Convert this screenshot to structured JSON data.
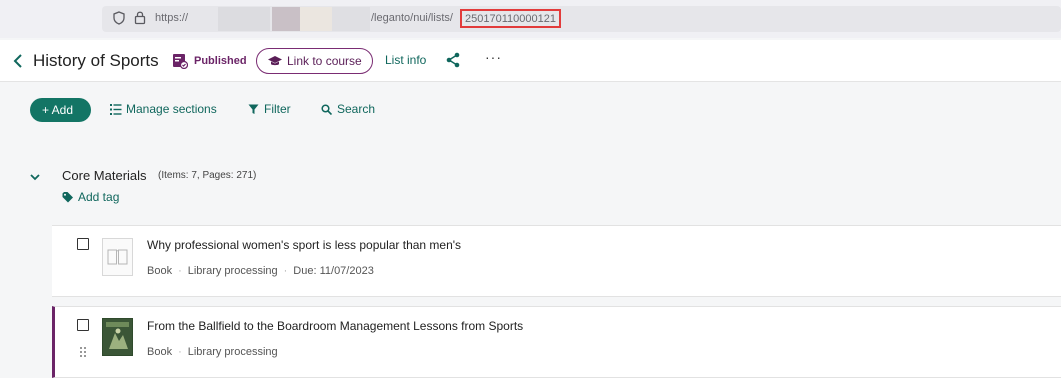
{
  "browser": {
    "url_protocol": "https://",
    "url_path": "/leganto/nui/lists/",
    "url_list_id": "250170110000121"
  },
  "header": {
    "title": "History of Sports",
    "status": "Published",
    "link_course_label": "Link to course",
    "list_info_label": "List info",
    "more_label": "···"
  },
  "toolbar": {
    "add_label": "+ Add",
    "manage_sections_label": "Manage sections",
    "filter_label": "Filter",
    "search_label": "Search"
  },
  "section": {
    "title": "Core Materials",
    "meta": "(Items: 7, Pages: 271)",
    "add_tag_label": "Add tag"
  },
  "items": [
    {
      "title": "Why professional women's sport is less popular than men's",
      "type": "Book",
      "status": "Library processing",
      "due": "Due: 11/07/2023"
    },
    {
      "title": "From the Ballfield to the Boardroom Management Lessons from Sports",
      "type": "Book",
      "status": "Library processing"
    }
  ],
  "colors": {
    "primary_green": "#137565",
    "link_green": "#10675d",
    "accent_purple": "#6b2467",
    "highlight_red": "#e23b3b"
  }
}
